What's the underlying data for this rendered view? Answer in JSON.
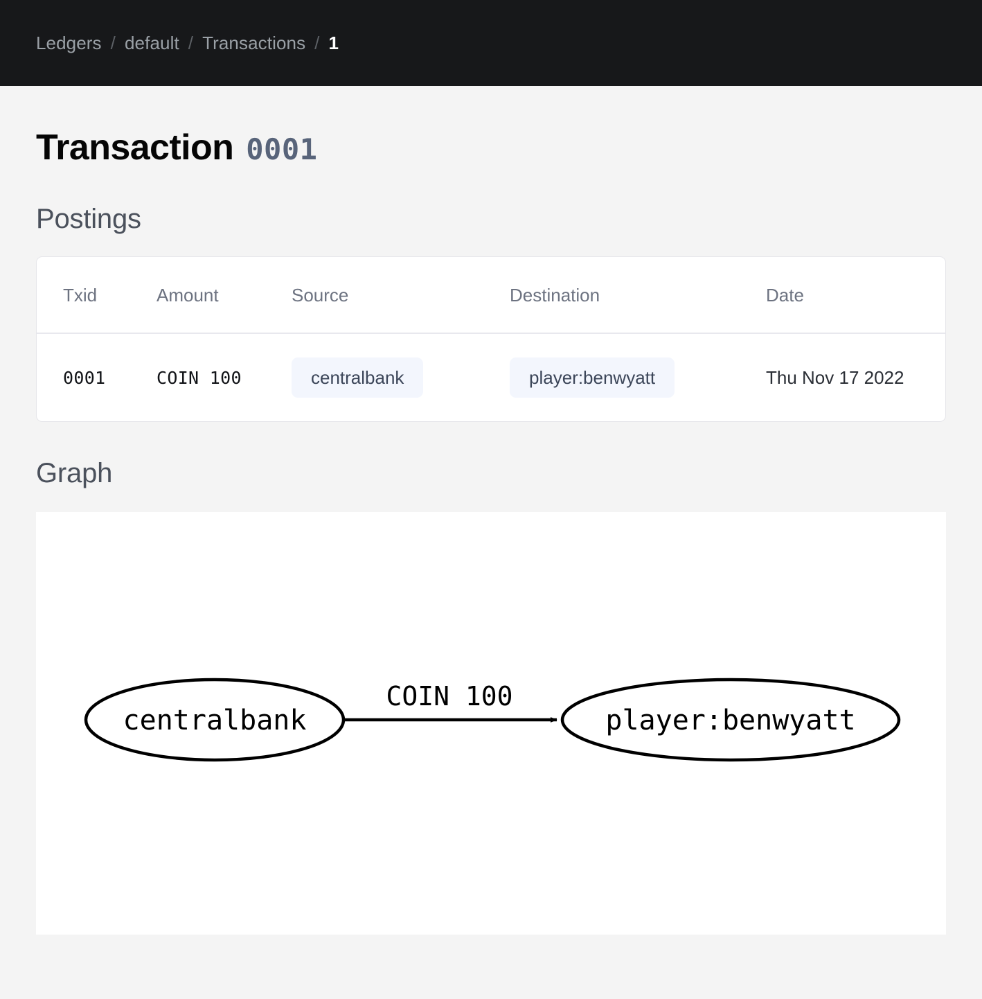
{
  "breadcrumb": {
    "separator": "/",
    "items": [
      {
        "label": "Ledgers",
        "current": false
      },
      {
        "label": "default",
        "current": false
      },
      {
        "label": "Transactions",
        "current": false
      },
      {
        "label": "1",
        "current": true
      }
    ]
  },
  "page": {
    "title": "Transaction",
    "transaction_id": "0001"
  },
  "sections": {
    "postings_heading": "Postings",
    "graph_heading": "Graph"
  },
  "postings_table": {
    "columns": [
      "Txid",
      "Amount",
      "Source",
      "Destination",
      "Date"
    ],
    "rows": [
      {
        "txid": "0001",
        "amount": "COIN 100",
        "source": "centralbank",
        "destination": "player:benwyatt",
        "date": "Thu Nov 17 2022"
      }
    ]
  },
  "graph": {
    "nodes": [
      {
        "id": "source",
        "label": "centralbank"
      },
      {
        "id": "destination",
        "label": "player:benwyatt"
      }
    ],
    "edges": [
      {
        "from": "centralbank",
        "to": "player:benwyatt",
        "label": "COIN 100"
      }
    ]
  },
  "colors": {
    "topbar_bg": "#17181a",
    "page_bg": "#f4f4f4",
    "card_bg": "#ffffff",
    "badge_bg": "#f3f6fd",
    "badge_text": "#3c4659",
    "accent_mono": "#58647a",
    "border": "#e6e6ea"
  }
}
